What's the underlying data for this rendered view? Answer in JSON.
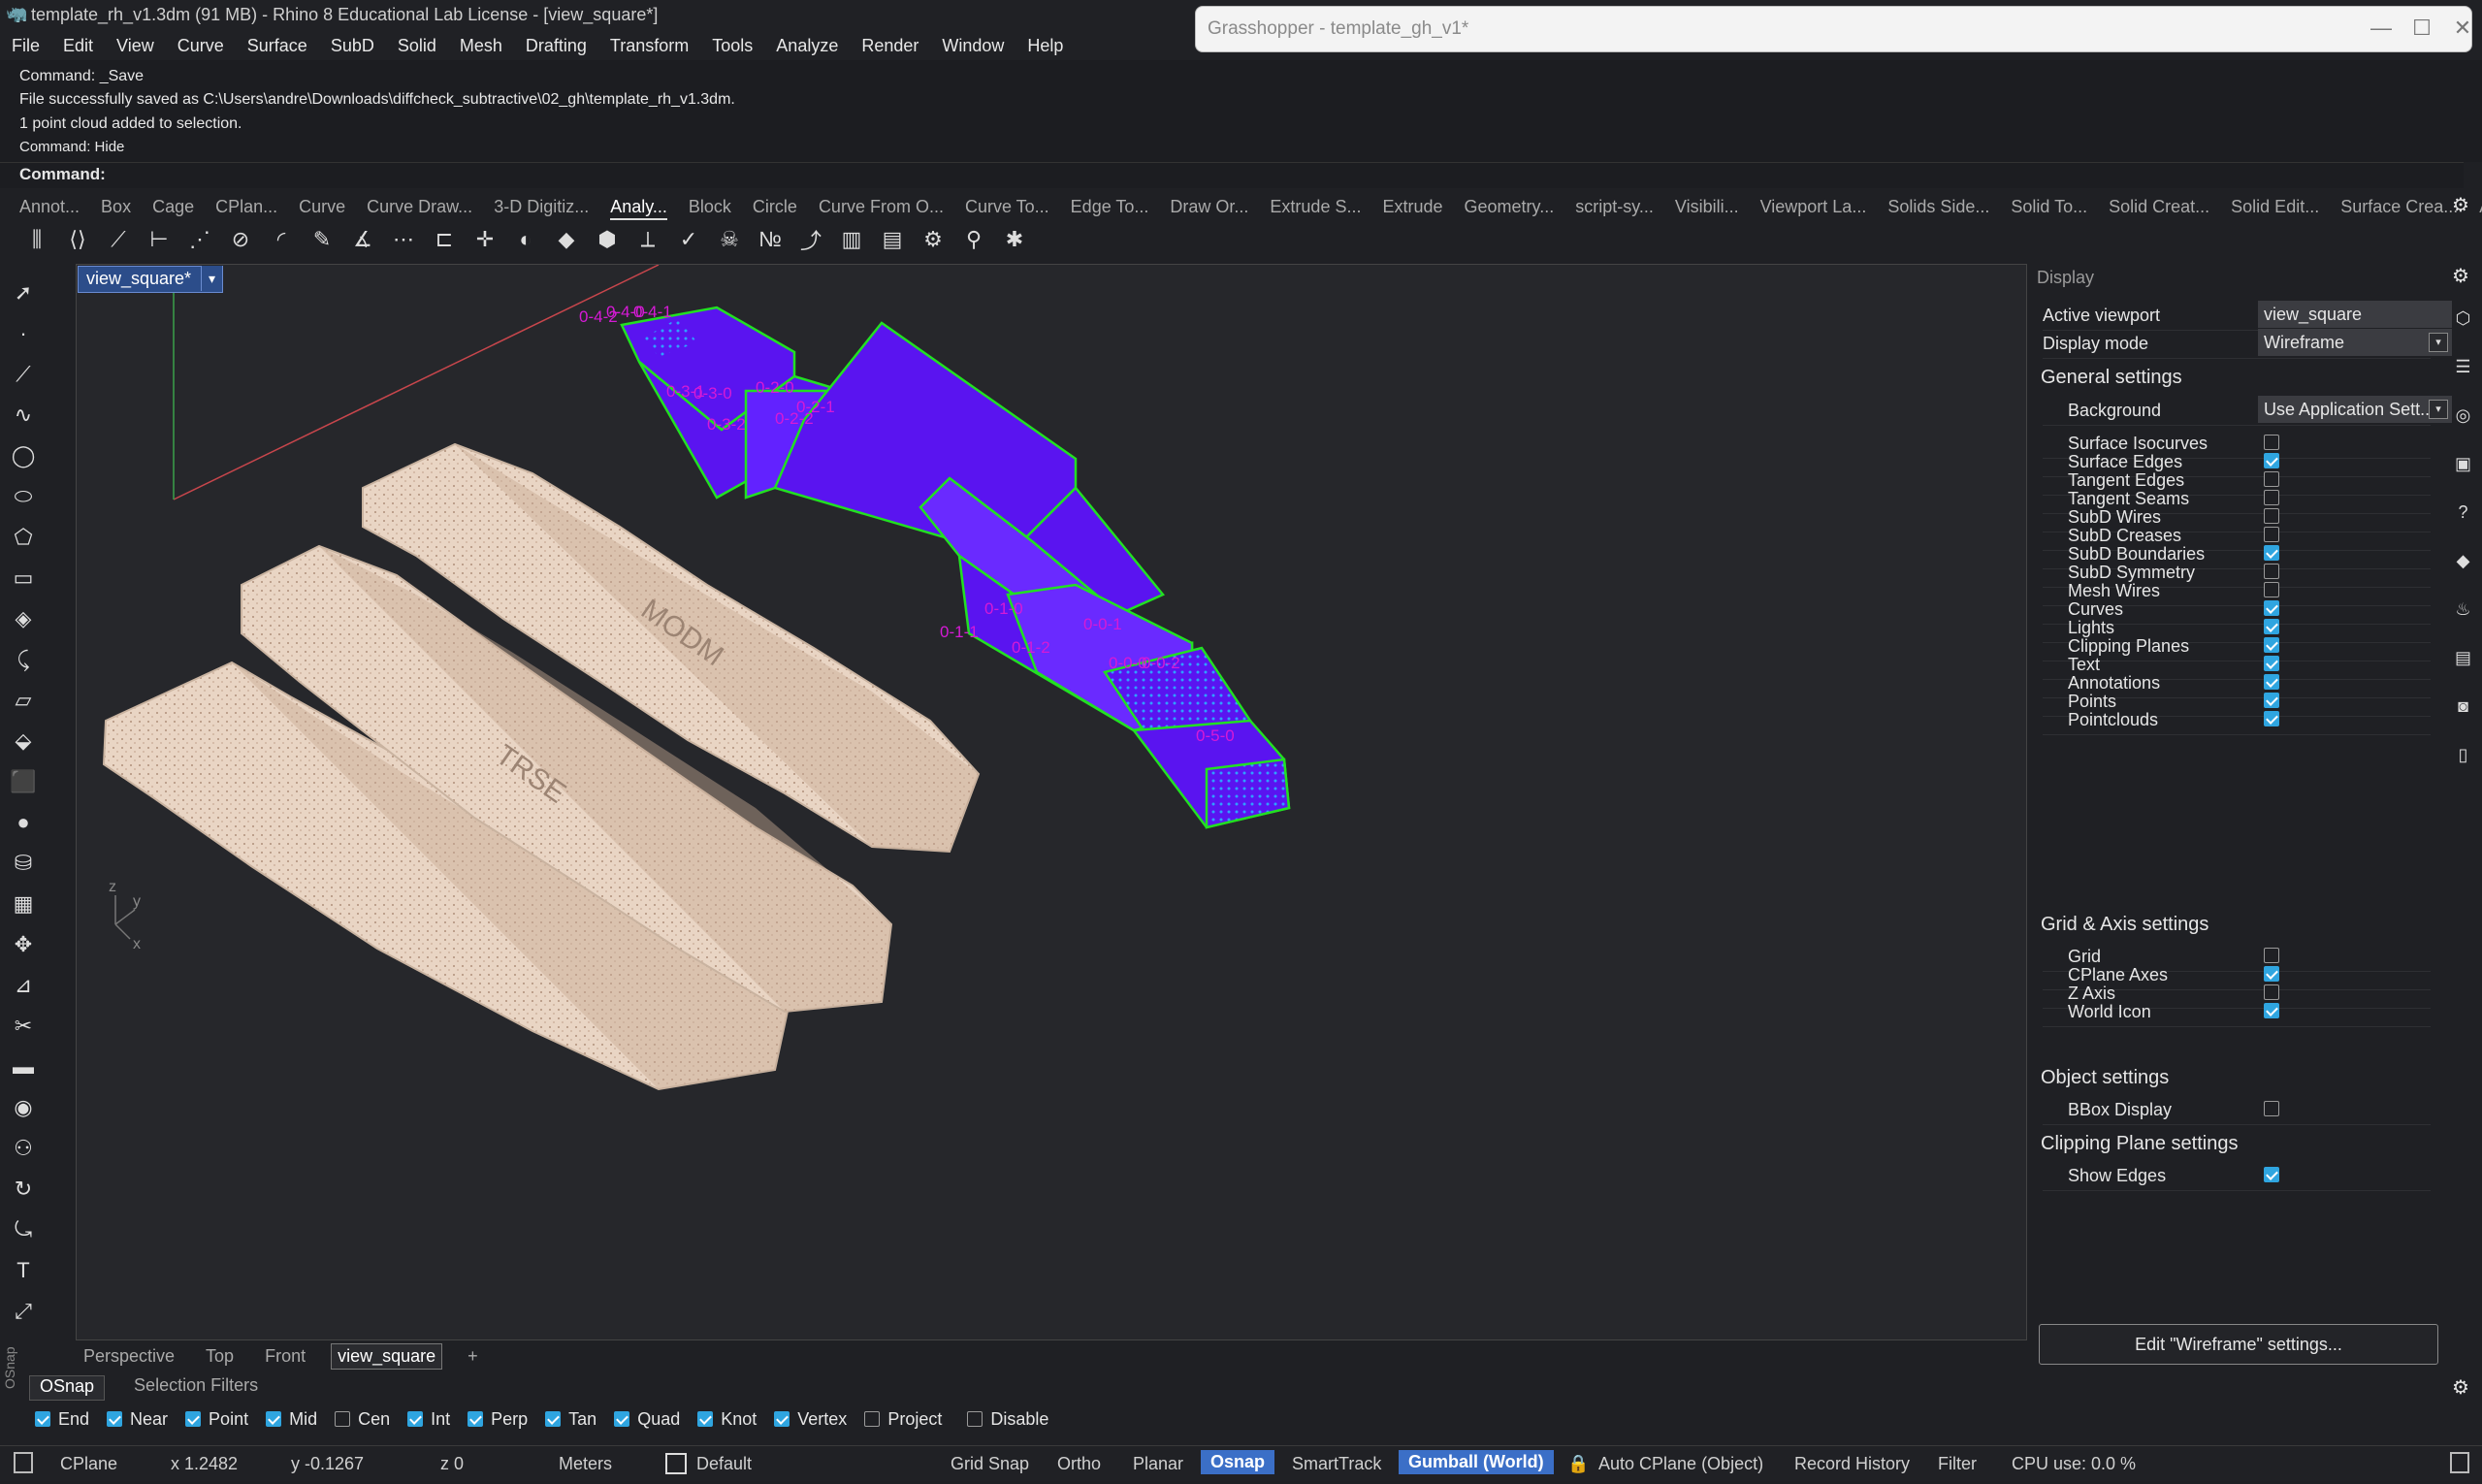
{
  "window": {
    "title": "template_rh_v1.3dm (91 MB) - Rhino 8 Educational Lab License - [view_square*]"
  },
  "menu": [
    "File",
    "Edit",
    "View",
    "Curve",
    "Surface",
    "SubD",
    "Solid",
    "Mesh",
    "Drafting",
    "Transform",
    "Tools",
    "Analyze",
    "Render",
    "Window",
    "Help"
  ],
  "grasshopper": {
    "title": "Grasshopper - template_gh_v1*",
    "minimize": "—",
    "maximize": "☐",
    "close": "✕"
  },
  "command_history": [
    "Command: _Save",
    "File successfully saved as C:\\Users\\andre\\Downloads\\diffcheck_subtractive\\02_gh\\template_rh_v1.3dm.",
    "1 point cloud added to selection.",
    "Command: Hide"
  ],
  "command_prompt": "Command:",
  "toolbar_tabs": [
    "Annot...",
    "Box",
    "Cage",
    "CPlan...",
    "Curve",
    "Curve Draw...",
    "3-D Digitiz...",
    "Analy...",
    "Block",
    "Circle",
    "Curve From O...",
    "Curve To...",
    "Edge To...",
    "Draw Or...",
    "Extrude S...",
    "Extrude",
    "Geometry...",
    "script-sy...",
    "Visibili...",
    "Viewport La...",
    "Solids Side...",
    "Solid To...",
    "Solid Creat...",
    "Solid Edit...",
    "Surface Crea...",
    "Arc"
  ],
  "active_tab": "Analy...",
  "toolbar_icons": [
    "ruler-icon",
    "xyz-icon",
    "distance-icon",
    "length-icon",
    "points-icon",
    "diameter-icon",
    "radius-icon",
    "edit-icon",
    "curvature-icon",
    "graph-icon",
    "continuity-icon",
    "direction-icon",
    "zebra-icon",
    "env-map-icon",
    "draft-angle-icon",
    "deviation-icon",
    "check-icon",
    "skull-icon",
    "count-icon",
    "pipette-icon",
    "grid-analysis-icon",
    "layers-icon",
    "gear-analysis-icon",
    "probe-icon",
    "bug-icon"
  ],
  "viewport": {
    "tab_label": "view_square*",
    "dropdown": "▾",
    "labels": [
      "0-4-2",
      "0-4-0",
      "0-4-1",
      "0-3-1",
      "0-3-0",
      "0-2-0",
      "0-2-1",
      "0-3-2",
      "0-2-2",
      "0-1-1",
      "0-1-0",
      "0-1-2",
      "0-0-1",
      "0-0-0",
      "0-0-2",
      "0-5-0"
    ],
    "axis": {
      "z": "z",
      "y": "y",
      "x": "x"
    },
    "engraving": [
      "MODM",
      "TRSE"
    ]
  },
  "view_tabs": [
    "Perspective",
    "Top",
    "Front",
    "view_square"
  ],
  "active_view": "view_square",
  "add_view": "+",
  "panel": {
    "header": "Display",
    "active_viewport_label": "Active viewport",
    "active_viewport_value": "view_square",
    "display_mode_label": "Display mode",
    "display_mode_value": "Wireframe",
    "sections": {
      "general": "General settings",
      "grid": "Grid & Axis settings",
      "object": "Object settings",
      "clipping": "Clipping Plane settings"
    },
    "background_label": "Background",
    "background_value": "Use Application Sett...",
    "general": [
      {
        "label": "Surface Isocurves",
        "checked": false
      },
      {
        "label": "Surface Edges",
        "checked": true
      },
      {
        "label": "Tangent Edges",
        "checked": false
      },
      {
        "label": "Tangent Seams",
        "checked": false
      },
      {
        "label": "SubD Wires",
        "checked": false
      },
      {
        "label": "SubD Creases",
        "checked": false
      },
      {
        "label": "SubD Boundaries",
        "checked": true
      },
      {
        "label": "SubD Symmetry",
        "checked": false
      },
      {
        "label": "Mesh Wires",
        "checked": false
      },
      {
        "label": "Curves",
        "checked": true
      },
      {
        "label": "Lights",
        "checked": true
      },
      {
        "label": "Clipping Planes",
        "checked": true
      },
      {
        "label": "Text",
        "checked": true
      },
      {
        "label": "Annotations",
        "checked": true
      },
      {
        "label": "Points",
        "checked": true
      },
      {
        "label": "Pointclouds",
        "checked": true
      }
    ],
    "grid": [
      {
        "label": "Grid",
        "checked": false
      },
      {
        "label": "CPlane Axes",
        "checked": true
      },
      {
        "label": "Z Axis",
        "checked": false
      },
      {
        "label": "World Icon",
        "checked": true
      }
    ],
    "object": [
      {
        "label": "BBox Display",
        "checked": false
      }
    ],
    "clipping": [
      {
        "label": "Show Edges",
        "checked": true
      }
    ],
    "edit_button": "Edit \"Wireframe\" settings..."
  },
  "osnap_tabs": [
    "OSnap",
    "Selection Filters"
  ],
  "osnap_side_label": "OSnap",
  "osnap": [
    {
      "label": "End",
      "checked": true
    },
    {
      "label": "Near",
      "checked": true
    },
    {
      "label": "Point",
      "checked": true
    },
    {
      "label": "Mid",
      "checked": true
    },
    {
      "label": "Cen",
      "checked": false
    },
    {
      "label": "Int",
      "checked": true
    },
    {
      "label": "Perp",
      "checked": true
    },
    {
      "label": "Tan",
      "checked": true
    },
    {
      "label": "Quad",
      "checked": true
    },
    {
      "label": "Knot",
      "checked": true
    },
    {
      "label": "Vertex",
      "checked": true
    },
    {
      "label": "Project",
      "checked": false
    },
    {
      "label": "Disable",
      "checked": false
    }
  ],
  "status": {
    "cplane": "CPlane",
    "x": "x 1.2482",
    "y": "y -0.1267",
    "z": "z 0",
    "units": "Meters",
    "layer": "Default",
    "grid_snap": "Grid Snap",
    "ortho": "Ortho",
    "planar": "Planar",
    "osnap": "Osnap",
    "smarttrack": "SmartTrack",
    "gumball": "Gumball (World)",
    "auto_cplane": "Auto CPlane (Object)",
    "record_history": "Record History",
    "filter": "Filter",
    "cpu": "CPU use: 0.0 %"
  },
  "colors": {
    "accent": "#3b6fc7",
    "boxes": "#5a14f0",
    "box_edges": "#22e022",
    "labels": "#d61ad6",
    "wood": "#e8d3c2"
  }
}
